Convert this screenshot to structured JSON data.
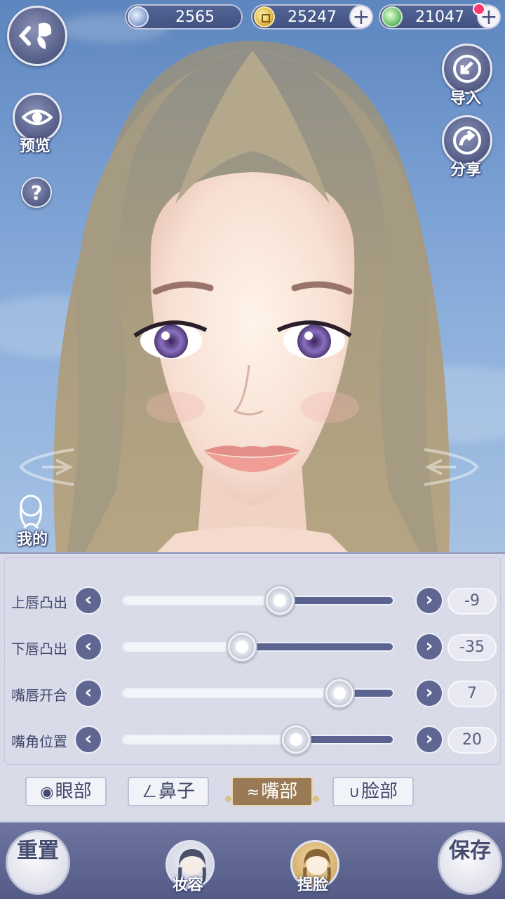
{
  "currencies": [
    {
      "id": "jade",
      "value": "2565",
      "icon": "jade-coin-icon",
      "has_plus": false
    },
    {
      "id": "copper",
      "value": "25247",
      "icon": "copper-coin-icon",
      "has_plus": true
    },
    {
      "id": "fish",
      "value": "21047",
      "icon": "green-token-icon",
      "has_plus": true,
      "has_notification": true
    }
  ],
  "plus_symbol": "+",
  "side_buttons": {
    "preview": "预览",
    "help": "?",
    "import": "导入",
    "share": "分享",
    "mine": "我的"
  },
  "sliders": [
    {
      "label": "上唇凸出",
      "value": "-9",
      "position": 0.58
    },
    {
      "label": "下唇凸出",
      "value": "-35",
      "position": 0.44
    },
    {
      "label": "嘴唇开合",
      "value": "7",
      "position": 0.8
    },
    {
      "label": "嘴角位置",
      "value": "20",
      "position": 0.64
    }
  ],
  "arrows": {
    "left": "‹",
    "right": "›"
  },
  "tabs": [
    {
      "id": "eyes",
      "label": "眼部",
      "icon": "eye-icon",
      "active": false
    },
    {
      "id": "nose",
      "label": "鼻子",
      "icon": "nose-icon",
      "active": false
    },
    {
      "id": "mouth",
      "label": "嘴部",
      "icon": "lips-icon",
      "active": true
    },
    {
      "id": "face",
      "label": "脸部",
      "icon": "face-outline-icon",
      "active": false
    }
  ],
  "bottom": {
    "reset": "重置",
    "makeup": "妆容",
    "face_shape": "捏脸",
    "save": "保存"
  },
  "colors": {
    "panel": "#d8dae8",
    "accent_dark": "#5b6390",
    "active_tab": "#9a7a55",
    "sky": "#7aa0d3"
  }
}
